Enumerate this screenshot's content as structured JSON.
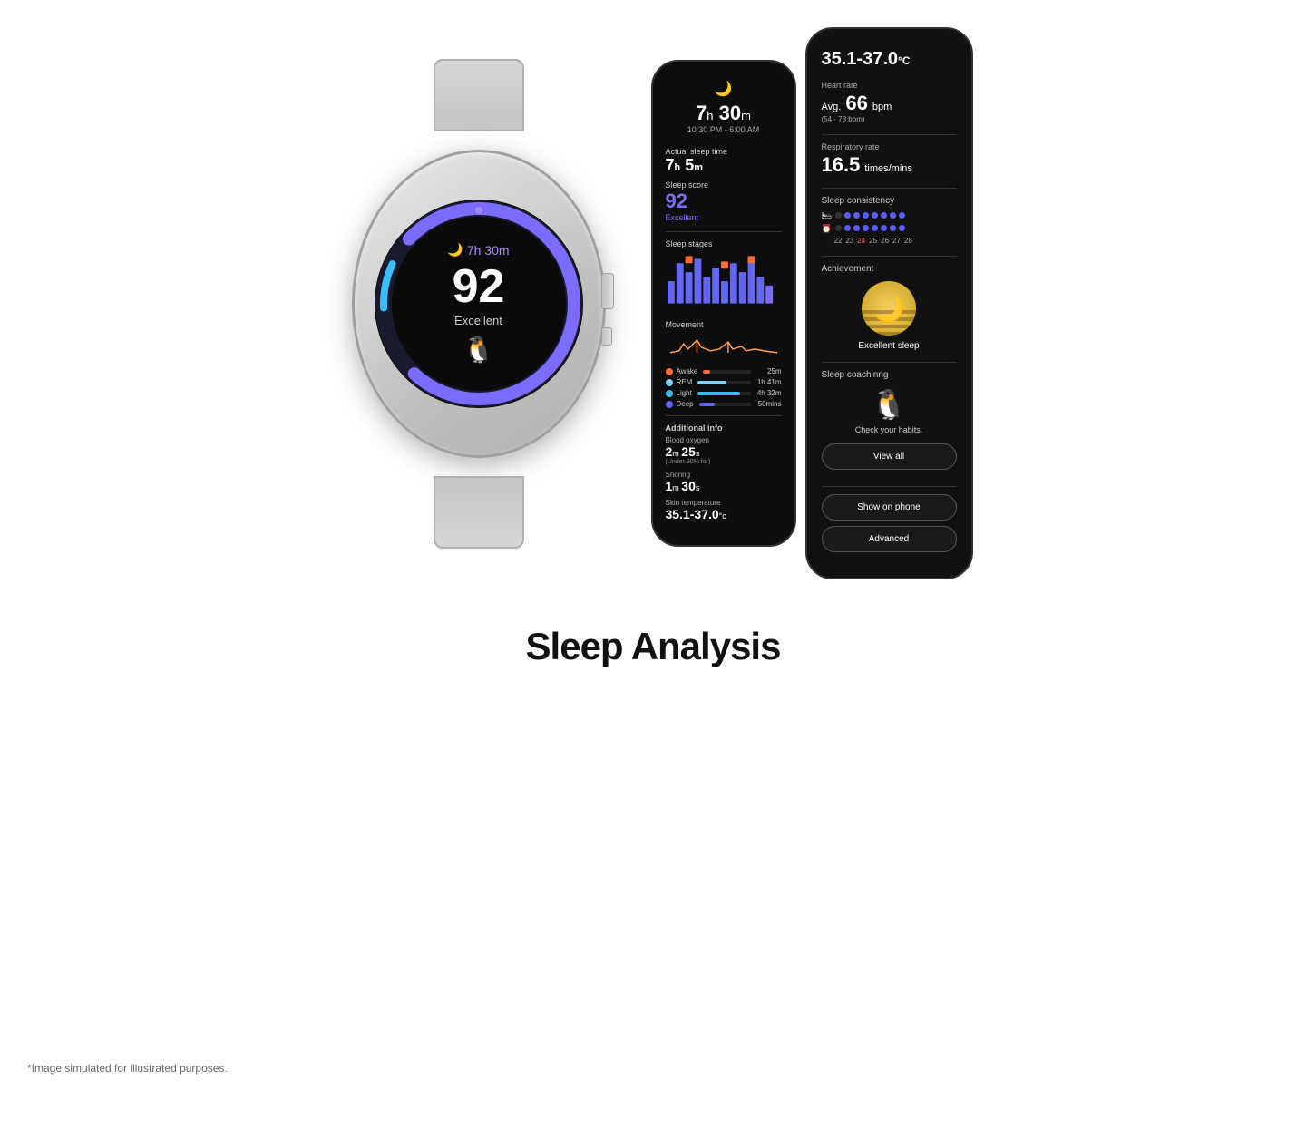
{
  "page": {
    "title": "Sleep Analysis",
    "disclaimer": "*Image simulated for illustrated purposes."
  },
  "watch": {
    "time": "7h 30m",
    "score": "92",
    "quality": "Excellent"
  },
  "phone1": {
    "moon_icon": "🌙",
    "total_hours": "7",
    "h_unit": "h",
    "total_mins": "30",
    "m_unit": "m",
    "time_range": "10:30 PM - 6:00 AM",
    "actual_label": "Actual sleep time",
    "actual_hours": "7",
    "actual_mins": "5",
    "score_label": "Sleep score",
    "score_num": "92",
    "score_text": "Excellent",
    "stages_label": "Sleep stages",
    "movement_label": "Movement",
    "awake_label": "Awake",
    "awake_dot_color": "#ff6b35",
    "awake_time": "25m",
    "rem_label": "REM",
    "rem_dot_color": "#7dd3fc",
    "rem_time": "1h 41m",
    "light_label": "Light",
    "light_dot_color": "#38bdf8",
    "light_time": "4h 32m",
    "deep_label": "Deep",
    "deep_dot_color": "#6366f1",
    "deep_time": "50mins",
    "additional_label": "Additional info",
    "blood_oxygen_label": "Blood oxygen",
    "blood_m": "2",
    "blood_s": "25",
    "blood_sub": "(Under 90% for)",
    "snoring_label": "Snoring",
    "snoring_m": "1",
    "snoring_s": "30",
    "skin_temp_label": "Skin temperature",
    "skin_temp": "35.1-37.0",
    "skin_temp_unit": "°c"
  },
  "phone2": {
    "temp_range": "35.1-37.0",
    "temp_unit": "°C",
    "heart_rate_label": "Heart rate",
    "avg_prefix": "Avg.",
    "avg_bpm": "66",
    "bpm_unit": "bpm",
    "heart_sub": "(54 - 78 bpm)",
    "respiratory_label": "Respiratory rate",
    "respiratory_value": "16.5",
    "respiratory_unit": "times/mins",
    "consistency_title": "Sleep consistency",
    "days": [
      "22",
      "23",
      "24",
      "25",
      "26",
      "27",
      "28"
    ],
    "day_highlight": "24",
    "achievement_title": "Achievement",
    "achievement_name": "Excellent sleep",
    "coaching_title": "Sleep coachinng",
    "coaching_text": "Check your habits.",
    "view_all": "View all",
    "show_on_phone": "Show on phone",
    "advanced": "Advanced"
  }
}
